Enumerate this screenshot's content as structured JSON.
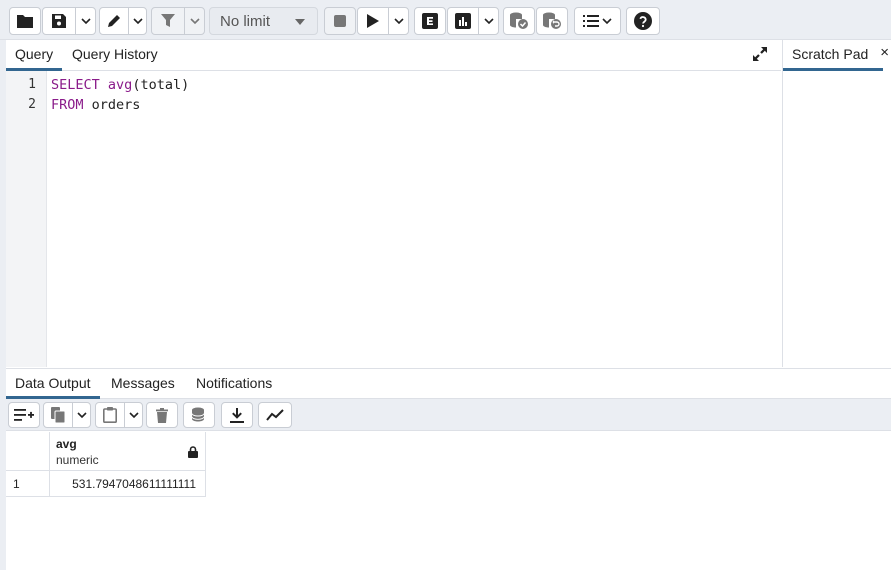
{
  "toolbar": {
    "row_limit": "No limit"
  },
  "query_tabs": [
    {
      "label": "Query"
    },
    {
      "label": "Query History"
    }
  ],
  "scratch_pad": {
    "label": "Scratch Pad",
    "close": "×"
  },
  "editor": {
    "line_numbers": [
      "1",
      "2"
    ],
    "line1": {
      "kw": "SELECT",
      "fn": "avg",
      "rest": "(total)"
    },
    "line2": {
      "kw": "FROM",
      "rest": "orders"
    }
  },
  "result_tabs": [
    {
      "label": "Data Output"
    },
    {
      "label": "Messages"
    },
    {
      "label": "Notifications"
    }
  ],
  "grid": {
    "columns": [
      {
        "name": "avg",
        "type": "numeric"
      }
    ],
    "rows": [
      {
        "num": "1",
        "values": [
          "531.7947048611111111"
        ]
      }
    ]
  },
  "colors": {
    "accent": "#326690",
    "keyword": "#8a1b8a",
    "toolbar_bg": "#ebeef3"
  }
}
